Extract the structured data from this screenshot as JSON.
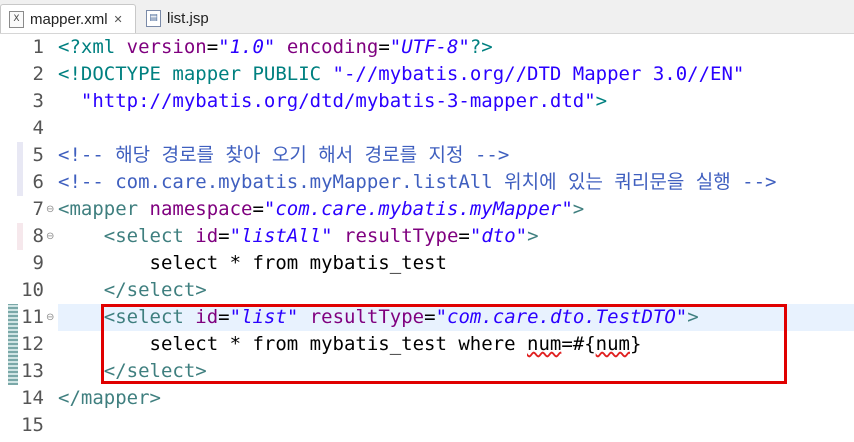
{
  "tabs": [
    {
      "label": "mapper.xml",
      "icon": "xml-file-icon",
      "active": true,
      "close": "✕"
    },
    {
      "label": "list.jsp",
      "icon": "jsp-file-icon",
      "active": false
    }
  ],
  "lines": [
    {
      "num": "1",
      "tokens": [
        [
          "t-pi",
          "<?xml "
        ],
        [
          "t-attr",
          "version"
        ],
        [
          "",
          "="
        ],
        [
          "t-val",
          "\"1.0\""
        ],
        [
          "",
          ""
        ],
        [
          "t-attr",
          " encoding"
        ],
        [
          "",
          "="
        ],
        [
          "t-val",
          "\"UTF-8\""
        ],
        [
          "t-pi",
          "?>"
        ]
      ]
    },
    {
      "num": "2",
      "tokens": [
        [
          "t-kw",
          "<!DOCTYPE mapper PUBLIC "
        ],
        [
          "t-str",
          "\"-//mybatis.org//DTD Mapper 3.0//EN\""
        ]
      ]
    },
    {
      "num": "3",
      "tokens": [
        [
          "",
          "  "
        ],
        [
          "t-str",
          "\"http://mybatis.org/dtd/mybatis-3-mapper.dtd\""
        ],
        [
          "t-kw",
          ">"
        ]
      ]
    },
    {
      "num": "4",
      "tokens": []
    },
    {
      "num": "5",
      "tokens": [
        [
          "t-com",
          "<!-- 해당 경로를 찾아 오기 해서 경로를 지정 -->"
        ]
      ]
    },
    {
      "num": "6",
      "tokens": [
        [
          "t-com",
          "<!-- com.care.mybatis.myMapper.listAll 위치에 있는 쿼리문을 실행 -->"
        ]
      ]
    },
    {
      "num": "7",
      "fold": "⊖",
      "tokens": [
        [
          "t-tag",
          "<mapper "
        ],
        [
          "t-attr",
          "namespace"
        ],
        [
          "",
          "="
        ],
        [
          "t-val",
          "\"com.care.mybatis.myMapper\""
        ],
        [
          "t-tag",
          ">"
        ]
      ]
    },
    {
      "num": "8",
      "fold": "⊖",
      "tokens": [
        [
          "",
          "    "
        ],
        [
          "t-tag",
          "<select "
        ],
        [
          "t-attr",
          "id"
        ],
        [
          "",
          "="
        ],
        [
          "t-val",
          "\"listAll\""
        ],
        [
          "t-attr",
          " resultType"
        ],
        [
          "",
          "="
        ],
        [
          "t-val",
          "\"dto\""
        ],
        [
          "t-tag",
          ">"
        ]
      ]
    },
    {
      "num": "9",
      "tokens": [
        [
          "",
          "        select * from mybatis_test"
        ]
      ]
    },
    {
      "num": "10",
      "tokens": [
        [
          "",
          "    "
        ],
        [
          "t-tag",
          "</select>"
        ]
      ]
    },
    {
      "num": "11",
      "fold": "⊖",
      "tokens": [
        [
          "",
          "    "
        ],
        [
          "t-tag",
          "<select "
        ],
        [
          "t-attr",
          "id"
        ],
        [
          "",
          "="
        ],
        [
          "t-val",
          "\"list\""
        ],
        [
          "t-attr",
          " resultType"
        ],
        [
          "",
          "="
        ],
        [
          "t-val",
          "\"com.care.dto.TestDTO\""
        ],
        [
          "t-tag",
          ">"
        ]
      ]
    },
    {
      "num": "12",
      "tokens": [
        [
          "",
          "        select * from mybatis_test where "
        ],
        [
          "squig",
          "num"
        ],
        [
          "",
          "=#{"
        ],
        [
          "squig",
          "num"
        ],
        [
          "",
          "}"
        ]
      ]
    },
    {
      "num": "13",
      "tokens": [
        [
          "",
          "    "
        ],
        [
          "t-tag",
          "</select>"
        ]
      ]
    },
    {
      "num": "14",
      "tokens": [
        [
          "t-tag",
          "</mapper>"
        ]
      ]
    },
    {
      "num": "15",
      "tokens": []
    }
  ]
}
